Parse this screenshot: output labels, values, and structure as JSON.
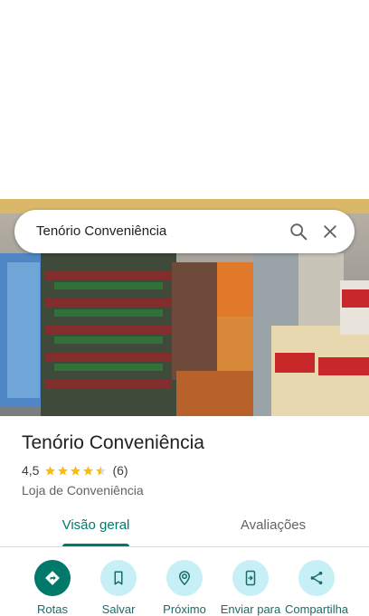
{
  "search": {
    "query": "Tenório Conveniência"
  },
  "place": {
    "title": "Tenório Conveniência",
    "rating": "4,5",
    "rating_value": 4.5,
    "review_count": "(6)",
    "category": "Loja de Conveniência"
  },
  "tabs": [
    {
      "label": "Visão geral",
      "active": true
    },
    {
      "label": "Avaliações",
      "active": false
    }
  ],
  "actions": [
    {
      "label": "Rotas",
      "icon": "directions-icon"
    },
    {
      "label": "Salvar",
      "icon": "bookmark-icon"
    },
    {
      "label": "Próximo",
      "icon": "nearby-icon"
    },
    {
      "label": "Enviar para",
      "icon": "send-to-phone-icon"
    },
    {
      "label": "Compartilha",
      "icon": "share-icon"
    }
  ],
  "colors": {
    "accent": "#00796b",
    "action_bg": "#c7f0f6",
    "star": "#fbbc04"
  }
}
